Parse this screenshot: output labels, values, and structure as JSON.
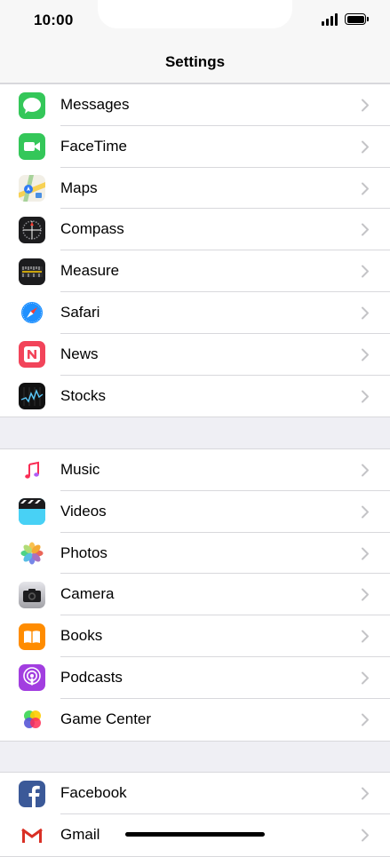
{
  "status": {
    "time": "10:00"
  },
  "nav": {
    "title": "Settings"
  },
  "groups": [
    {
      "items": [
        {
          "label": "Messages",
          "icon": "messages-icon"
        },
        {
          "label": "FaceTime",
          "icon": "facetime-icon"
        },
        {
          "label": "Maps",
          "icon": "maps-icon"
        },
        {
          "label": "Compass",
          "icon": "compass-icon"
        },
        {
          "label": "Measure",
          "icon": "measure-icon"
        },
        {
          "label": "Safari",
          "icon": "safari-icon"
        },
        {
          "label": "News",
          "icon": "news-icon"
        },
        {
          "label": "Stocks",
          "icon": "stocks-icon"
        }
      ]
    },
    {
      "items": [
        {
          "label": "Music",
          "icon": "music-icon"
        },
        {
          "label": "Videos",
          "icon": "videos-icon"
        },
        {
          "label": "Photos",
          "icon": "photos-icon"
        },
        {
          "label": "Camera",
          "icon": "camera-icon"
        },
        {
          "label": "Books",
          "icon": "books-icon"
        },
        {
          "label": "Podcasts",
          "icon": "podcasts-icon"
        },
        {
          "label": "Game Center",
          "icon": "game-center-icon"
        }
      ]
    },
    {
      "items": [
        {
          "label": "Facebook",
          "icon": "facebook-icon"
        },
        {
          "label": "Gmail",
          "icon": "gmail-icon"
        }
      ]
    }
  ]
}
